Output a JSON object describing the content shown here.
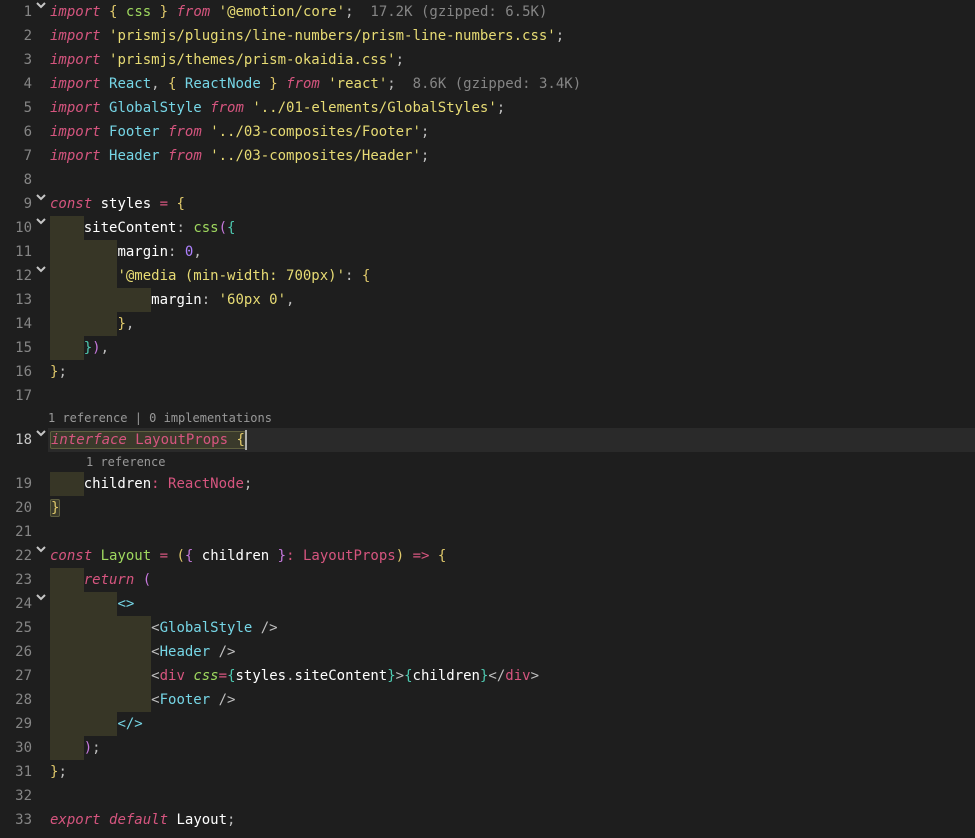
{
  "codelens": {
    "l18": "1 reference | 0 implementations",
    "l19": "1 reference"
  },
  "hints": {
    "l1": "17.2K (gzipped: 6.5K)",
    "l4": "8.6K (gzipped: 3.4K)"
  },
  "file": {
    "language": "typescript-react",
    "lines": [
      "import { css } from '@emotion/core';",
      "import 'prismjs/plugins/line-numbers/prism-line-numbers.css';",
      "import 'prismjs/themes/prism-okaidia.css';",
      "import React, { ReactNode } from 'react';",
      "import GlobalStyle from '../01-elements/GlobalStyles';",
      "import Footer from '../03-composites/Footer';",
      "import Header from '../03-composites/Header';",
      "",
      "const styles = {",
      "    siteContent: css({",
      "        margin: 0,",
      "        '@media (min-width: 700px)': {",
      "            margin: '60px 0',",
      "        },",
      "    }),",
      "};",
      "",
      "interface LayoutProps {",
      "    children: ReactNode;",
      "}",
      "",
      "const Layout = ({ children }: LayoutProps) => {",
      "    return (",
      "        <>",
      "            <GlobalStyle />",
      "            <Header />",
      "            <div css={styles.siteContent}>{children}</div>",
      "            <Footer />",
      "        </>",
      "    );",
      "};",
      "",
      "export default Layout;"
    ]
  },
  "gutter": [
    "1",
    "2",
    "3",
    "4",
    "5",
    "6",
    "7",
    "8",
    "9",
    "10",
    "11",
    "12",
    "13",
    "14",
    "15",
    "16",
    "17",
    "18",
    "19",
    "20",
    "21",
    "22",
    "23",
    "24",
    "25",
    "26",
    "27",
    "28",
    "29",
    "30",
    "31",
    "32",
    "33"
  ],
  "foldable": [
    1,
    9,
    10,
    12,
    18,
    22,
    24
  ]
}
